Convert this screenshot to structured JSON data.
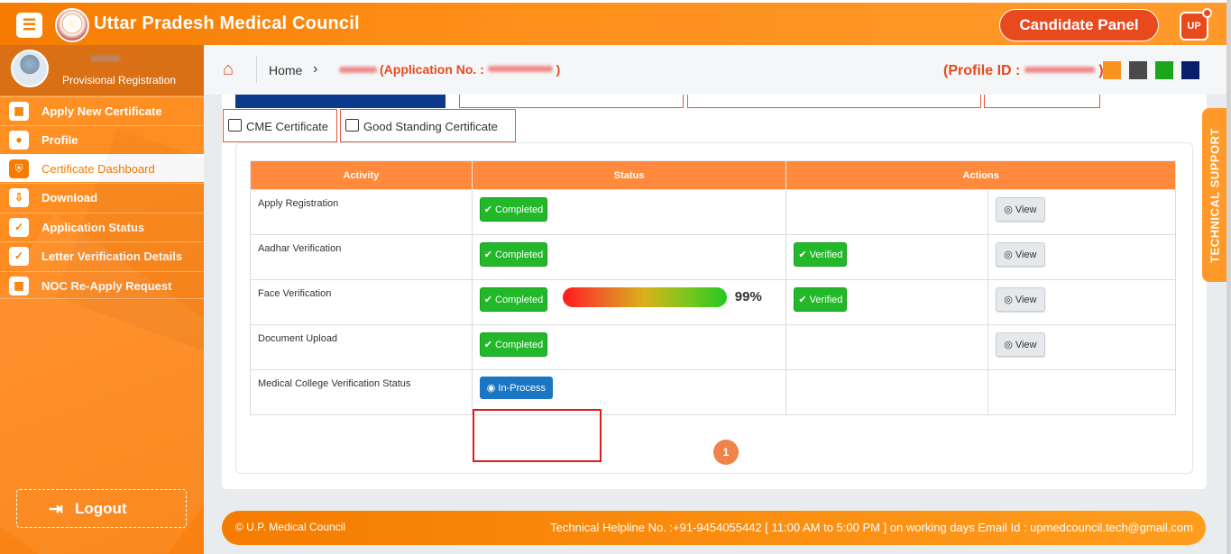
{
  "header": {
    "menu_icon": "☰",
    "title": "Uttar Pradesh Medical Council",
    "candidate_panel_label": "Candidate Panel",
    "user_badge": "UP"
  },
  "sidebar": {
    "user_subtitle": "Provisional Registration",
    "items": [
      {
        "label": "Apply New Certificate",
        "icon": "grid-icon",
        "glyph": "▦"
      },
      {
        "label": "Profile",
        "icon": "user-icon",
        "glyph": "●"
      },
      {
        "label": "Certificate Dashboard",
        "icon": "shield-icon",
        "glyph": "⛨"
      },
      {
        "label": "Download",
        "icon": "download-icon",
        "glyph": "⇩"
      },
      {
        "label": "Application Status",
        "icon": "check-circle-icon",
        "glyph": "✓"
      },
      {
        "label": "Letter Verification Details",
        "icon": "check-circle-icon",
        "glyph": "✓"
      },
      {
        "label": "NOC Re-Apply Request",
        "icon": "grid-icon",
        "glyph": "▦"
      }
    ],
    "active_index": 2,
    "logout_label": "Logout"
  },
  "breadcrumb": {
    "home": "Home",
    "application_label": "(Application No. :",
    "application_close": ")",
    "profile_id_label": "(Profile ID :",
    "profile_id_close": ")"
  },
  "theme_swatches": [
    "#f7941d",
    "#4a4a4a",
    "#1aa51a",
    "#0a1f6b"
  ],
  "tabs": [
    {
      "label": "CME Certificate"
    },
    {
      "label": "Good Standing Certificate"
    }
  ],
  "table": {
    "headers": [
      "Activity",
      "Status",
      "Actions"
    ],
    "rows": [
      {
        "activity": "Apply Registration",
        "status": "✔ Completed",
        "action_status": "",
        "action": "◎ View"
      },
      {
        "activity": "Aadhar Verification",
        "status": "✔ Completed",
        "action_status": "✔ Verified",
        "action": "◎ View"
      },
      {
        "activity": "Face Verification",
        "status": "✔ Completed",
        "progress": "99%",
        "progress_fraction": 0.99,
        "action_status": "✔ Verified",
        "action": "◎ View"
      },
      {
        "activity": "Document Upload",
        "status": "✔ Completed",
        "action_status": "",
        "action": "◎ View"
      },
      {
        "activity": "Medical College Verification Status",
        "status": "◉ In-Process",
        "action_status": "",
        "action": ""
      }
    ]
  },
  "pagination": {
    "current": "1"
  },
  "footer": {
    "left": "© U.P. Medical Council",
    "right": "Technical Helpline No. :+91-9454055442 [ 11:00 AM to 5:00 PM ] on working days  Email Id : upmedcouncil.tech@gmail.com"
  },
  "technical_support_label": "TECHNICAL SUPPORT",
  "colors": {
    "brand_orange": "#f57c00",
    "accent_red": "#e84a1e",
    "success_green": "#22b82a",
    "in_process_blue": "#1a76c2",
    "table_header": "#ff8a3d"
  }
}
